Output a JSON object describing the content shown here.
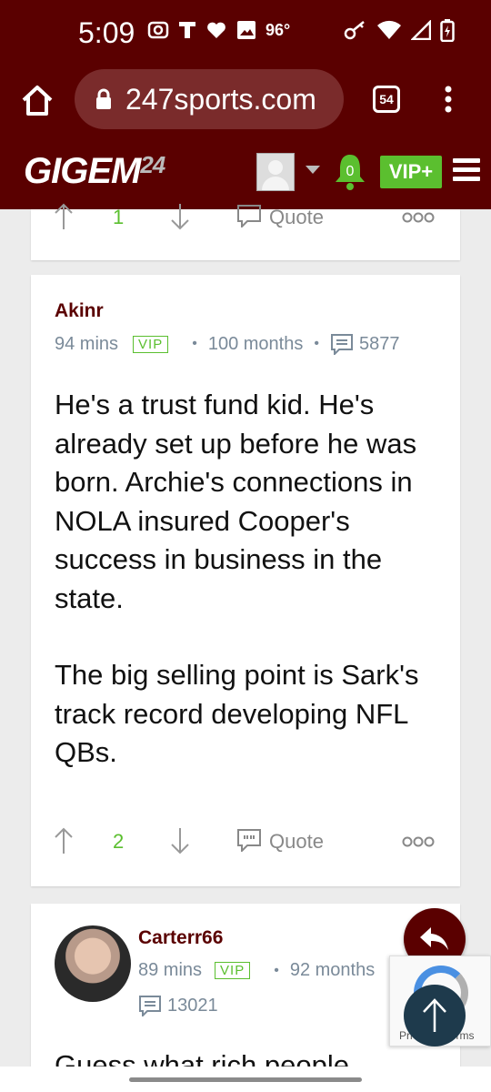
{
  "status_bar": {
    "time": "5:09",
    "temperature": "96°",
    "icons": [
      "camera-icon",
      "t-mobile-icon",
      "heart-icon",
      "image-icon",
      "key-icon",
      "wifi-icon",
      "signal-icon",
      "battery-icon"
    ]
  },
  "browser": {
    "url": "247sports.com",
    "tab_count": "54"
  },
  "site": {
    "logo_text": "GIGEM",
    "logo_number": "24",
    "notification_count": "0",
    "vip_button": "VIP+"
  },
  "previous_post": {
    "upvotes": "1",
    "quote_label": "Quote"
  },
  "post": {
    "author": "Akinr",
    "time_ago": "94 mins",
    "vip_tag": "VIP",
    "membership": "100 months",
    "post_count": "5877",
    "paragraph1": "He's a trust fund kid. He's already set up before he was born. Archie's connections in NOLA insured Cooper's success in business in the state.",
    "paragraph2": "The big selling point is Sark's track record developing NFL QBs.",
    "upvotes": "2",
    "quote_label": "Quote"
  },
  "next_post": {
    "author": "Carterr66",
    "time_ago": "89 mins",
    "vip_tag": "VIP",
    "membership": "92 months",
    "post_count": "13021",
    "snippet": "Guess what rich people"
  },
  "recaptcha": {
    "text": "Privacy - Terms"
  },
  "colors": {
    "brand": "#5a0000",
    "vip_green": "#5bbf2f",
    "meta_gray": "#7a8a99"
  }
}
